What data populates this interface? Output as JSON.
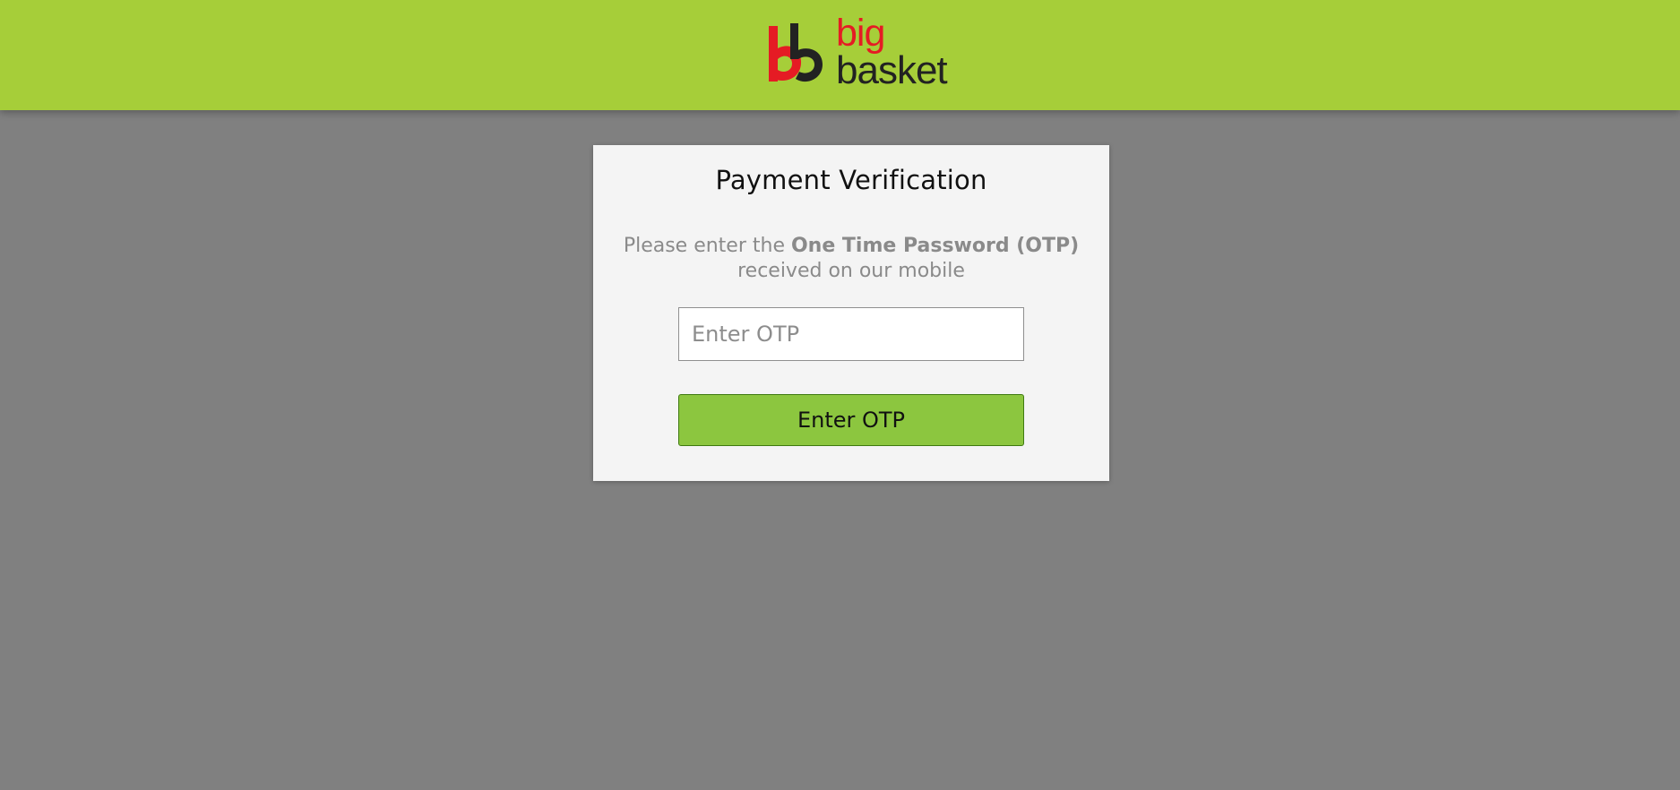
{
  "header": {
    "logo": {
      "word_top": "big",
      "word_bottom": "basket",
      "colors": {
        "brand_red": "#e51b24",
        "brand_dark": "#222222"
      }
    },
    "background_color": "#a6ce39"
  },
  "verification": {
    "title": "Payment Verification",
    "instruction_prefix": "Please enter the ",
    "instruction_emphasis": "One Time Password (OTP)",
    "instruction_suffix": "received on our mobile",
    "otp_input": {
      "value": "",
      "placeholder": "Enter OTP"
    },
    "submit_label": "Enter OTP",
    "button_color": "#8cc63f"
  },
  "page": {
    "background_color": "#808080"
  }
}
